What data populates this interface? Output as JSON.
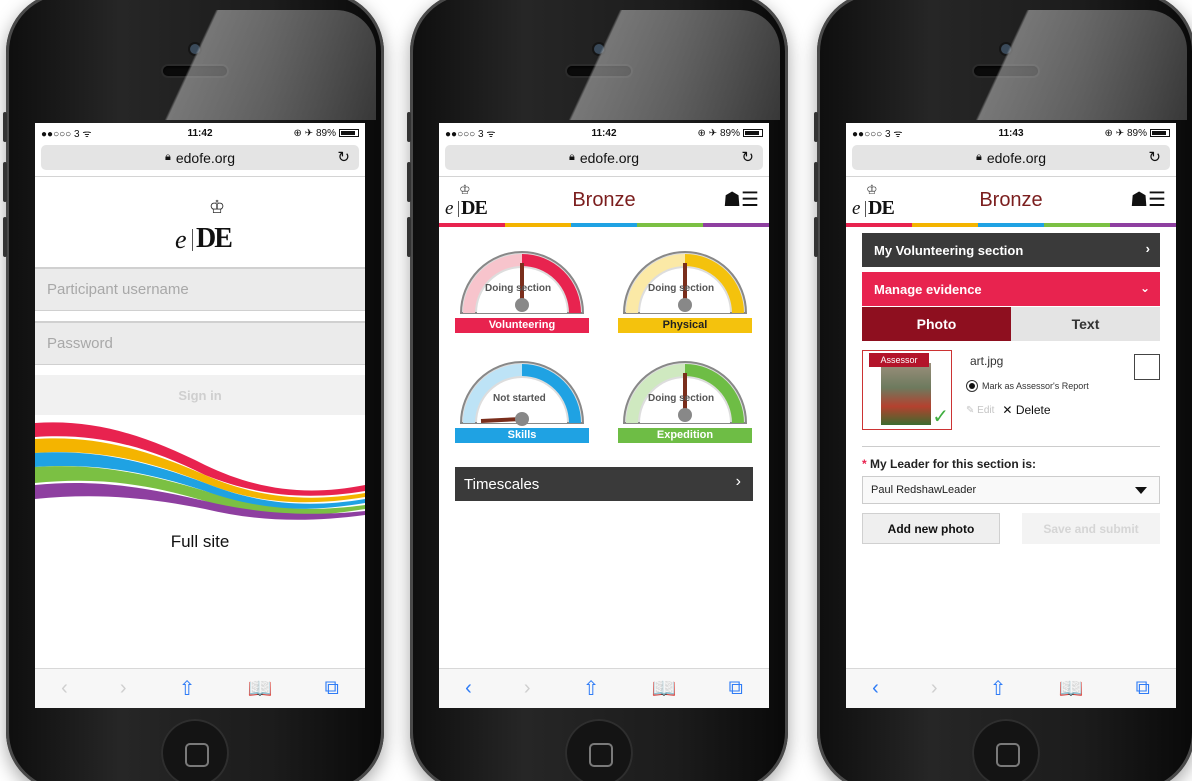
{
  "browser": {
    "url": "edofe.org",
    "carrier": "●●○○○ 3 ᯤ",
    "battery": "89%",
    "toolbar": {
      "back": "‹",
      "forward": "›",
      "share": "⇧",
      "bookmarks": "📖",
      "tabs": "⧉"
    }
  },
  "phones": [
    {
      "time": "11:42",
      "logo": {
        "e": "e",
        "de": "DE"
      },
      "username_placeholder": "Participant username",
      "password_placeholder": "Password",
      "signin_label": "Sign in",
      "fullsite_label": "Full site",
      "swoosh_colors": [
        "#e8234f",
        "#f4b400",
        "#1fa2e3",
        "#7bc043",
        "#8e3fa0"
      ]
    },
    {
      "time": "11:42",
      "logo": {
        "e": "e",
        "de": "DE"
      },
      "title": "Bronze",
      "gauges": [
        {
          "label": "Volunteering",
          "status": "Doing section",
          "color": "#e8234f",
          "light": "#f7c4cc",
          "level": 1.0
        },
        {
          "label": "Physical",
          "status": "Doing section",
          "color": "#f4c20d",
          "light": "#fbe9a6",
          "level": 1.0
        },
        {
          "label": "Skills",
          "status": "Not started",
          "color": "#1fa2e3",
          "light": "#bde3f6",
          "level": 0.0
        },
        {
          "label": "Expedition",
          "status": "Doing section",
          "color": "#6ebd45",
          "light": "#cfe9c0",
          "level": 1.0
        }
      ],
      "timescales_label": "Timescales"
    },
    {
      "time": "11:43",
      "logo": {
        "e": "e",
        "de": "DE"
      },
      "title": "Bronze",
      "section_label": "My Volunteering section",
      "manage_label": "Manage evidence",
      "tabs": [
        "Photo",
        "Text"
      ],
      "evidence": {
        "filename": "art.jpg",
        "badge": "Assessor",
        "radio_label": "Mark as Assessor's Report",
        "edit_label": "Edit",
        "delete_label": "Delete"
      },
      "leader_label": "My Leader for this section is:",
      "leader_value": "Paul RedshawLeader",
      "add_photo_label": "Add new photo",
      "save_label": "Save and submit"
    }
  ],
  "rainbow": [
    "#e8234f",
    "#f4b400",
    "#1fa2e3",
    "#7bc043",
    "#8e3fa0"
  ]
}
